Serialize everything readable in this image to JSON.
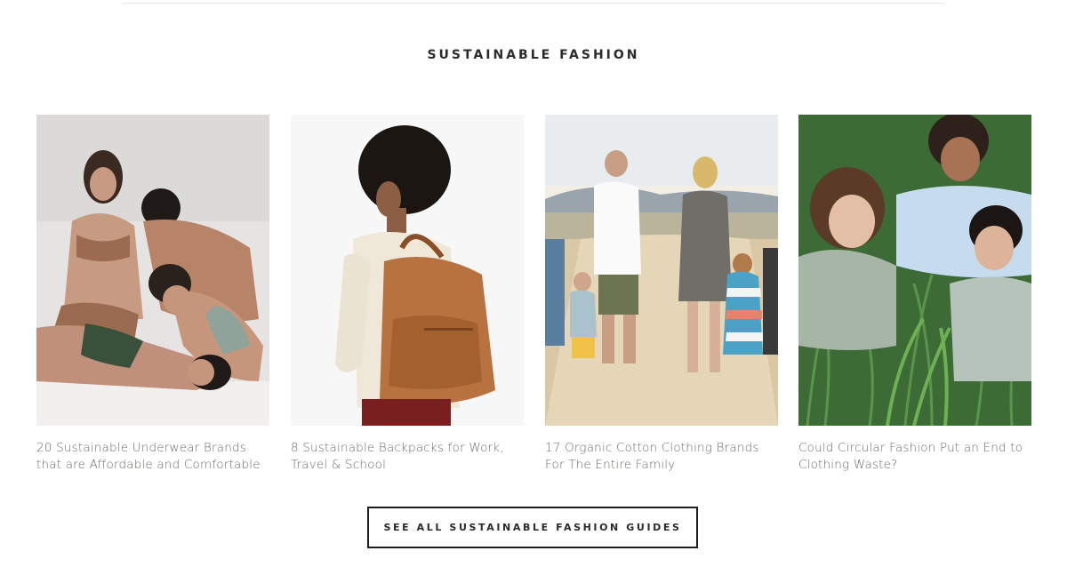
{
  "section": {
    "title": "SUSTAINABLE FASHION"
  },
  "cards": [
    {
      "caption": "20 Sustainable Underwear Brands that are Affordable and Comfortable"
    },
    {
      "caption": "8 Sustainable Backpacks for Work, Travel & School"
    },
    {
      "caption": "17 Organic Cotton Clothing Brands For The Entire Family"
    },
    {
      "caption": "Could Circular Fashion Put an End to Clothing Waste?"
    }
  ],
  "cta": {
    "label": "SEE ALL SUSTAINABLE FASHION GUIDES"
  }
}
